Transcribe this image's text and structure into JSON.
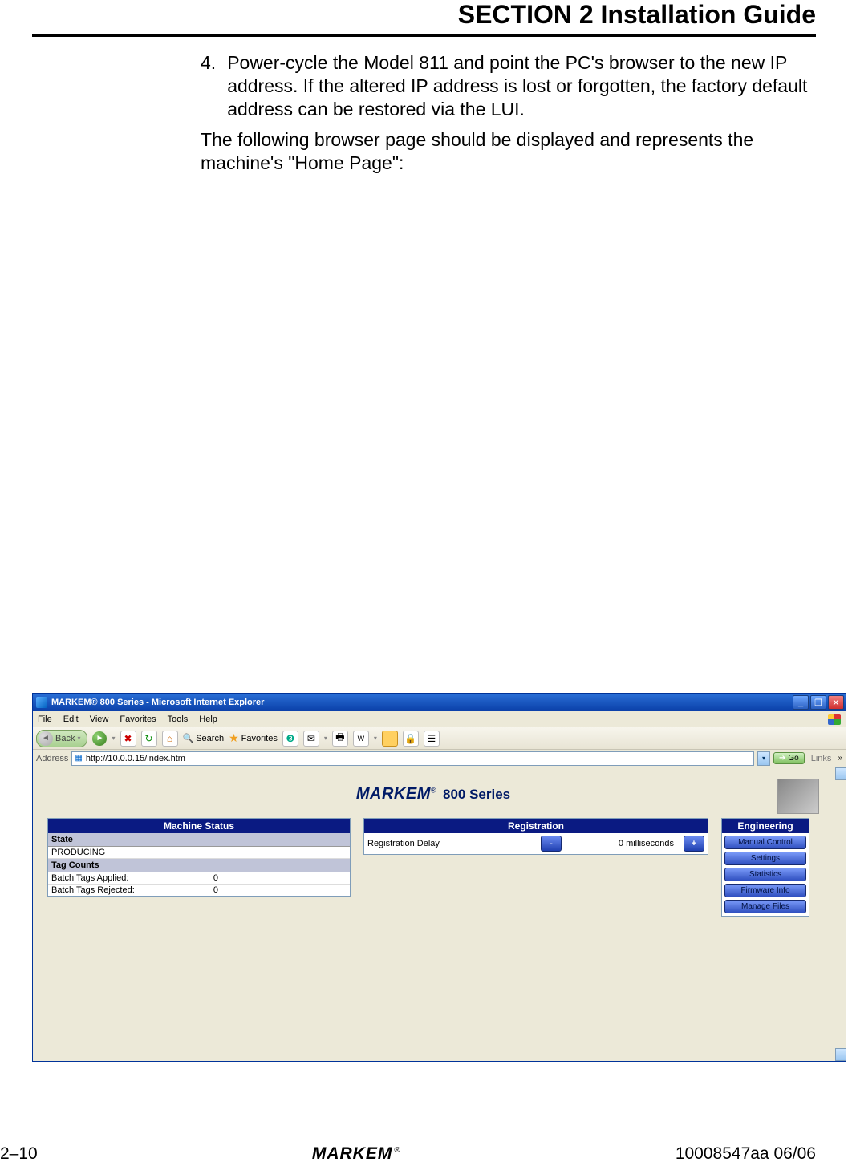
{
  "section_title": "SECTION 2 Installation Guide",
  "list_number": "4.",
  "list_text": "Power-cycle the Model 811 and point the PC's browser to the new IP address.  If the altered IP address is lost or forgotten, the factory default address can be restored via the LUI.",
  "para": "The following browser page should be displayed and represents the machine's \"Home Page\":",
  "browser": {
    "title": "MARKEM® 800 Series - Microsoft Internet Explorer",
    "menu": [
      "File",
      "Edit",
      "View",
      "Favorites",
      "Tools",
      "Help"
    ],
    "back": "Back",
    "search": "Search",
    "favorites": "Favorites",
    "address_label": "Address",
    "url": "http://10.0.0.15/index.htm",
    "go": "Go",
    "links": "Links",
    "logo": "MARKEM",
    "reg": "®",
    "series": "800 Series",
    "status": {
      "title": "Machine Status",
      "state_hdr": "State",
      "state_val": "PRODUCING",
      "tag_hdr": "Tag Counts",
      "rows": [
        {
          "label": "Batch Tags Applied:",
          "value": "0"
        },
        {
          "label": "Batch Tags Rejected:",
          "value": "0"
        }
      ]
    },
    "registration": {
      "title": "Registration",
      "label": "Registration Delay",
      "minus": "-",
      "value": "0 milliseconds",
      "plus": "+"
    },
    "engineering": {
      "title": "Engineering",
      "buttons": [
        "Manual Control",
        "Settings",
        "Statistics",
        "Firmware Info",
        "Manage Files"
      ]
    }
  },
  "footer": {
    "left": "2–10",
    "logo": "MARKEM",
    "reg": "®",
    "right": "10008547aa 06/06"
  }
}
